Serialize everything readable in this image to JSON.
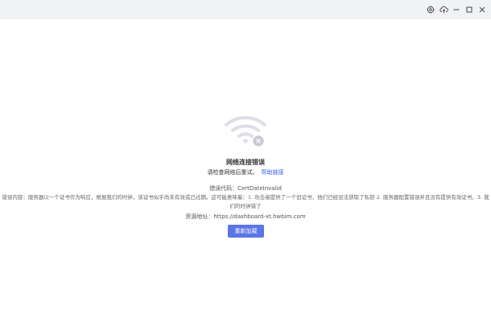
{
  "window": {
    "controls": [
      {
        "name": "settings-icon"
      },
      {
        "name": "cloud-upload-icon"
      },
      {
        "name": "minimize-icon"
      },
      {
        "name": "maximize-icon"
      },
      {
        "name": "close-icon"
      }
    ]
  },
  "error": {
    "icon": "wifi-disconnected-icon",
    "title": "网络连接错误",
    "hint": "请检查网络后重试。",
    "help_link": "帮助链接",
    "code_label": "错误代码：",
    "code_value": "CertDateInvalid",
    "detail_label": "错误内容：",
    "detail_text": "服务器以一个证书作为响应，根据我们的时钟，该证书似乎尚未有效或已过期。这可能意味着：1. 攻击者提供了一个旧证书，他们已经设法获取了私钥 2. 服务器配置错误并且没有提供有效证书。3. 我们的时钟错了",
    "source_label": "资源地址：",
    "source_value": "https://dashboard-xt.hwbim.com",
    "reload_label": "重新加载"
  },
  "colors": {
    "accent": "#5b74e6",
    "link": "#3b63e6",
    "titlebar": "#f1f2f4"
  }
}
